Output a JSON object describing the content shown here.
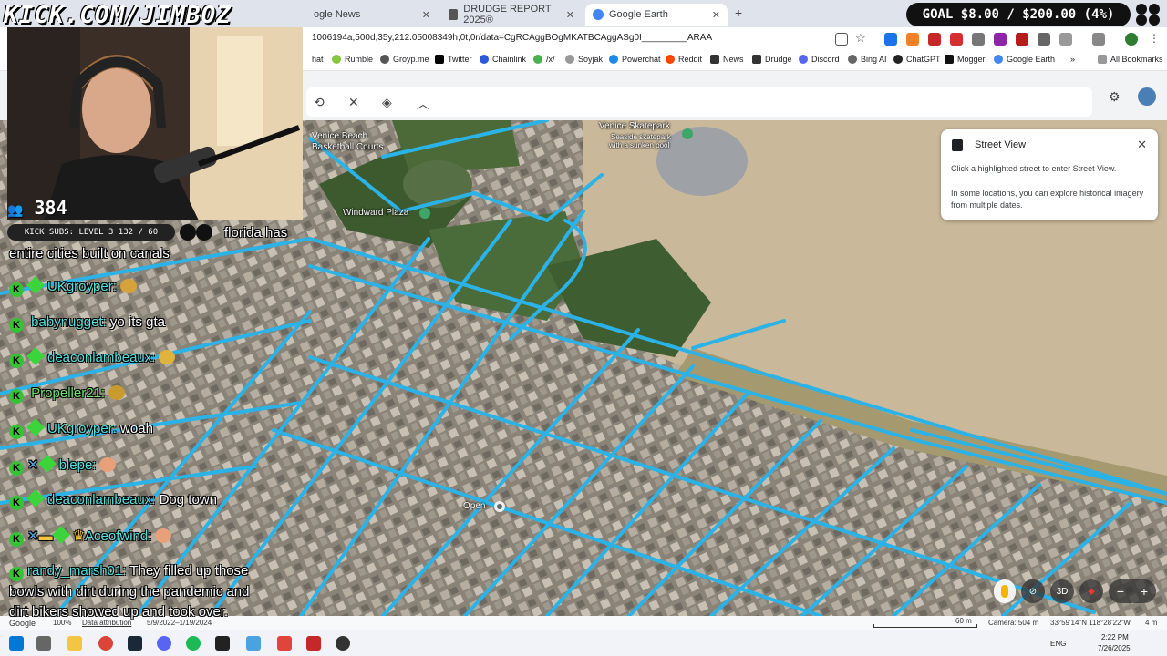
{
  "browser": {
    "tabs": [
      {
        "label": "ogle News",
        "active": false
      },
      {
        "label": "DRUDGE REPORT 2025®",
        "active": false
      },
      {
        "label": "Google Earth",
        "active": true
      }
    ],
    "url": "1006194a,500d,35y,212.05008349h,0t,0r/data=CgRCAggBOgMKATBCAggASg0I_________ARAA",
    "bookmarks": [
      "hat",
      "Rumble",
      "Groyp.me",
      "Twitter",
      "Chainlink",
      "/x/",
      "Soyjak",
      "Powerchat",
      "Reddit",
      "News",
      "Drudge",
      "Discord",
      "Bing AI",
      "ChatGPT",
      "Mogger",
      "Google Earth",
      "All Bookmarks"
    ]
  },
  "stream": {
    "brand": "KICK.COM/JIMBOZ",
    "goal": "GOAL $8.00 / $200.00 (4%)",
    "viewers": "384",
    "subs": "KICK SUBS: LEVEL 3 132 / 60"
  },
  "chat": [
    {
      "user": "",
      "text": "florida has",
      "cont": "entire cities built on canals"
    },
    {
      "user": "UKgroyper:",
      "text": ""
    },
    {
      "user": "babynugget:",
      "text": "yo its gta"
    },
    {
      "user": "deaconlambeaux:",
      "text": ""
    },
    {
      "user": "Propeller21:",
      "text": ""
    },
    {
      "user": "UKgroyper:",
      "text": "woah"
    },
    {
      "user": "blepe:",
      "text": ""
    },
    {
      "user": "deaconlambeaux:",
      "text": "Dog town"
    },
    {
      "user": "Aceofwind:",
      "text": ""
    },
    {
      "user": "randy_marsh01:",
      "text": "They filled up those",
      "cont1": "bowls with dirt during the pandemic and",
      "cont2": "dirt bikers showed up and took over."
    }
  ],
  "map": {
    "labels": {
      "venice_beach": "Venice Beach",
      "basketball": "Basketball Courts",
      "skatepark": "Venice Skatepark",
      "skatepark_sub1": "Seaside skatepark",
      "skatepark_sub2": "with a sunken pool",
      "windward": "Windward Plaza",
      "open": "Open"
    },
    "colors": {
      "streets": "#2bb3e8",
      "sand": "#c9b89a",
      "grass": "#4a6b3a"
    }
  },
  "street_view": {
    "title": "Street View",
    "body1": "Click a highlighted street to enter Street View.",
    "body2": "In some locations, you can explore historical imagery from multiple dates."
  },
  "map_controls": {
    "threeD": "3D",
    "zoom_out": "−",
    "zoom_in": "+"
  },
  "map_footer": {
    "google": "Google",
    "zoom": "100%",
    "attribution": "Data attribution",
    "dates": "5/9/2022–1/19/2024",
    "scale": "60 m",
    "camera": "Camera: 504 m",
    "coords": "33°59'14\"N 118°28'22\"W",
    "altitude": "4 m"
  },
  "taskbar": {
    "lang": "ENG",
    "time": "2:22 PM",
    "date": "7/26/2025"
  }
}
